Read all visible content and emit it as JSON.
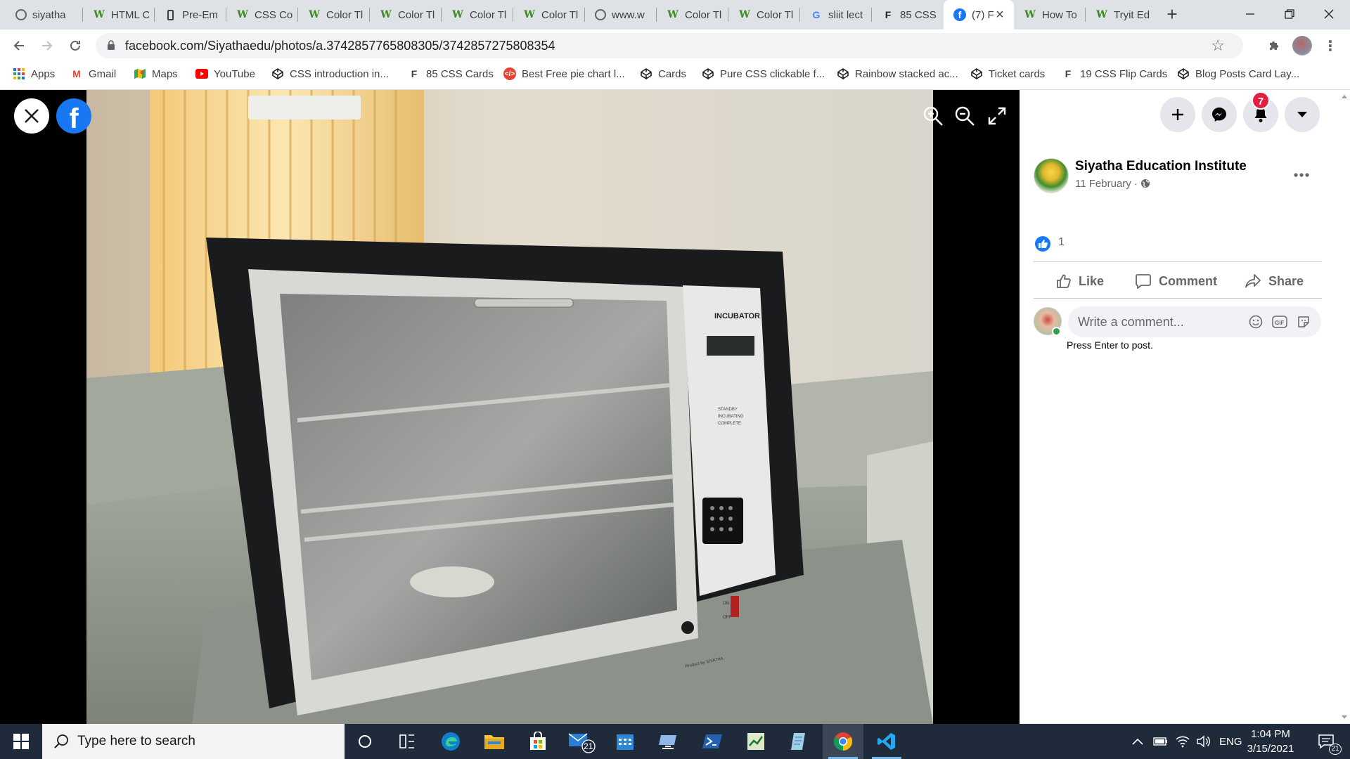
{
  "browser": {
    "tabs": [
      {
        "title": "siyatha",
        "icon": "globe-icon"
      },
      {
        "title": "HTML C",
        "icon": "w3schools-icon"
      },
      {
        "title": "Pre-Em",
        "icon": "phone-icon"
      },
      {
        "title": "CSS Col",
        "icon": "w3schools-icon"
      },
      {
        "title": "Color Tl",
        "icon": "w3schools-icon"
      },
      {
        "title": "Color Tl",
        "icon": "w3schools-icon"
      },
      {
        "title": "Color Tl",
        "icon": "w3schools-icon"
      },
      {
        "title": "Color Tl",
        "icon": "w3schools-icon"
      },
      {
        "title": "www.w",
        "icon": "globe-icon"
      },
      {
        "title": "Color Tl",
        "icon": "w3schools-icon"
      },
      {
        "title": "Color Tl",
        "icon": "w3schools-icon"
      },
      {
        "title": "sliit lect",
        "icon": "google-icon"
      },
      {
        "title": "85 CSS",
        "icon": "f-icon"
      },
      {
        "title": "(7) F",
        "icon": "facebook-icon",
        "active": true
      },
      {
        "title": "How To",
        "icon": "w3schools-icon"
      },
      {
        "title": "Tryit Ed",
        "icon": "w3schools-icon"
      }
    ],
    "url": "facebook.com/Siyathaedu/photos/a.3742857765808305/3742857275808354",
    "bookmarks": [
      {
        "label": "Apps",
        "icon": "apps-grid-icon"
      },
      {
        "label": "Gmail",
        "icon": "gmail-icon"
      },
      {
        "label": "Maps",
        "icon": "maps-icon"
      },
      {
        "label": "YouTube",
        "icon": "youtube-icon"
      },
      {
        "label": "CSS introduction in...",
        "icon": "codepen-icon"
      },
      {
        "label": "85 CSS Cards",
        "icon": "f-icon"
      },
      {
        "label": "Best Free pie chart l...",
        "icon": "code-icon"
      },
      {
        "label": "Cards",
        "icon": "codepen-icon"
      },
      {
        "label": "Pure CSS clickable f...",
        "icon": "codepen-icon"
      },
      {
        "label": "Rainbow stacked ac...",
        "icon": "codepen-icon"
      },
      {
        "label": "Ticket cards",
        "icon": "codepen-icon"
      },
      {
        "label": "19 CSS Flip Cards",
        "icon": "f-icon"
      },
      {
        "label": "Blog Posts Card Lay...",
        "icon": "codepen-icon"
      }
    ]
  },
  "photo": {
    "label": "INCUBATOR",
    "statuses": [
      "STANDBY",
      "INCUBATING",
      "COMPLETE"
    ],
    "switch_on": "ON",
    "switch_off": "OFF",
    "maker": "Product by SIYATHA"
  },
  "post": {
    "page_name": "Siyatha Education Institute",
    "date": "11 February",
    "date_sep": "·",
    "like_count": "1",
    "actions": {
      "like": "Like",
      "comment": "Comment",
      "share": "Share"
    },
    "comment_placeholder": "Write a comment...",
    "press_enter": "Press Enter to post.",
    "notifications": "7"
  },
  "taskbar": {
    "search_placeholder": "Type here to search",
    "mail_badge": "21",
    "language": "ENG",
    "time": "1:04 PM",
    "date": "3/15/2021",
    "notification_count": "21"
  },
  "colors": {
    "facebook_blue": "#1877f2",
    "notification_red": "#e41e3f",
    "taskbar": "#1f2b3a"
  }
}
